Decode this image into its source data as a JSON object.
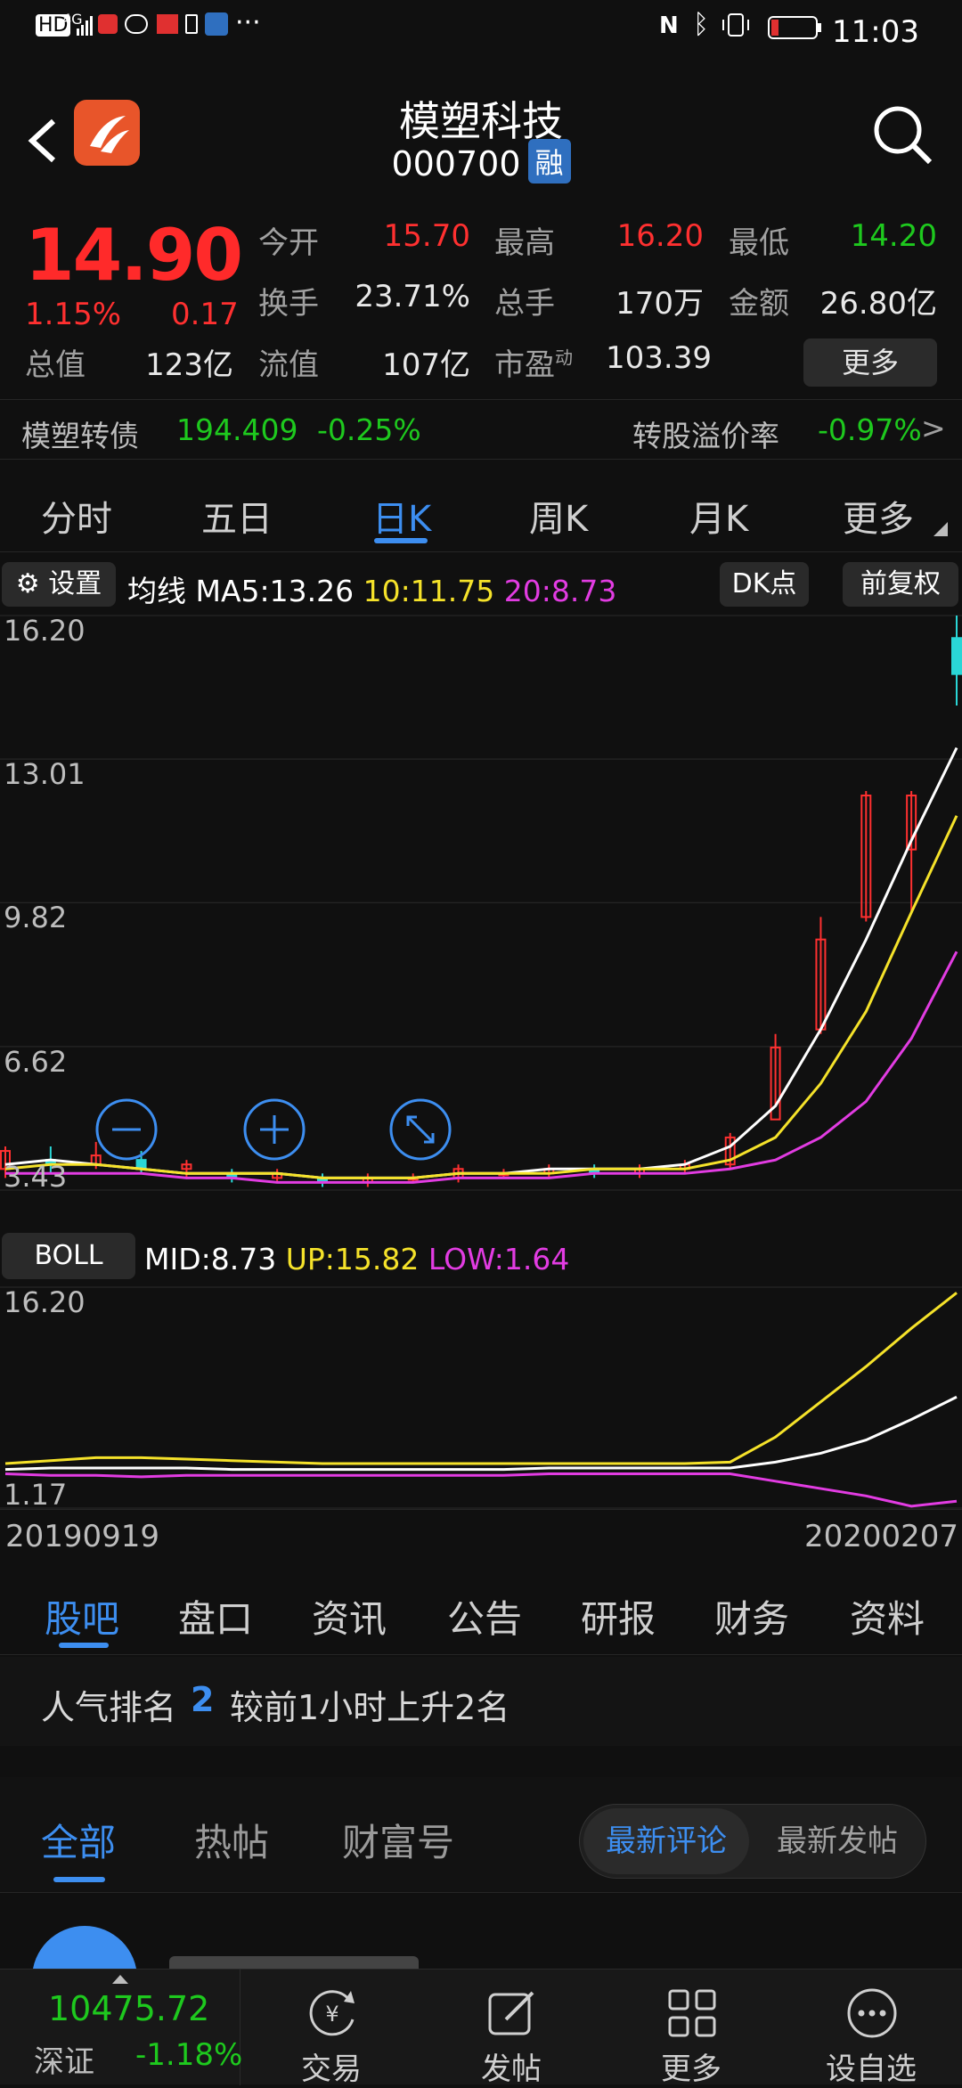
{
  "status": {
    "time": "11:03",
    "network": "4G",
    "hd": "HD",
    "more": "···"
  },
  "header": {
    "title": "模塑科技",
    "code": "000700",
    "badge": "融"
  },
  "quote": {
    "price": "14.90",
    "change_pct": "1.15%",
    "change": "0.17",
    "stats": [
      {
        "label": "今开",
        "value": "15.70"
      },
      {
        "label": "最高",
        "value": "16.20"
      },
      {
        "label": "最低",
        "value": "14.20"
      },
      {
        "label": "换手",
        "value": "23.71%"
      },
      {
        "label": "总手",
        "value": "170万"
      },
      {
        "label": "金额",
        "value": "26.80亿"
      },
      {
        "label": "总值",
        "value": "123亿"
      },
      {
        "label": "流值",
        "value": "107亿"
      },
      {
        "label": "市盈",
        "sup": "动",
        "value": "103.39"
      }
    ],
    "more_label": "更多"
  },
  "convertible": {
    "name": "模塑转债",
    "price": "194.409",
    "change": "-0.25%",
    "premium_label": "转股溢价率",
    "premium": "-0.97%",
    "arrow": ">"
  },
  "period_tabs": [
    "分时",
    "五日",
    "日K",
    "周K",
    "月K",
    "更多"
  ],
  "chart_bar": {
    "settings_label": "设置",
    "ma_label": "均线",
    "ma5": "MA5:13.26",
    "ma10": "10:11.75",
    "ma20": "20:8.73",
    "dk_label": "DK点",
    "adjust_label": "前复权"
  },
  "boll_bar": {
    "label": "BOLL",
    "mid": "MID:8.73",
    "up": "UP:15.82",
    "low": "LOW:1.64"
  },
  "axis": {
    "date_start": "20190919",
    "date_end": "20200207"
  },
  "colors": {
    "up": "#ff3030",
    "down": "#1ec91e",
    "accent": "#3d8ef0",
    "ma5": "#ffffff",
    "ma10": "#f5e22a",
    "ma20": "#e23ce2"
  },
  "chart_data": [
    {
      "type": "candlestick",
      "title": "",
      "y_ticks": [
        "16.20",
        "13.01",
        "9.82",
        "6.62",
        "3.43"
      ],
      "ylim": [
        3.43,
        16.2
      ],
      "x_range": [
        "20190919",
        "20200207"
      ],
      "series": [
        {
          "name": "MA5",
          "last": 13.26,
          "values": [
            4.0,
            4.1,
            4.0,
            3.9,
            3.8,
            3.8,
            3.8,
            3.7,
            3.7,
            3.7,
            3.8,
            3.8,
            3.9,
            3.9,
            3.9,
            4.0,
            4.4,
            5.3,
            7.0,
            9.0,
            11.2,
            13.26
          ]
        },
        {
          "name": "10",
          "last": 11.75,
          "values": [
            3.9,
            4.0,
            4.0,
            3.9,
            3.8,
            3.8,
            3.8,
            3.7,
            3.7,
            3.7,
            3.8,
            3.8,
            3.8,
            3.9,
            3.9,
            3.9,
            4.1,
            4.6,
            5.8,
            7.4,
            9.6,
            11.75
          ]
        },
        {
          "name": "20",
          "last": 8.73,
          "values": [
            3.8,
            3.8,
            3.8,
            3.8,
            3.7,
            3.7,
            3.6,
            3.6,
            3.6,
            3.6,
            3.7,
            3.7,
            3.7,
            3.8,
            3.8,
            3.8,
            3.9,
            4.1,
            4.6,
            5.4,
            6.8,
            8.73
          ]
        }
      ],
      "candles": [
        {
          "o": 3.9,
          "c": 4.3,
          "h": 4.4,
          "l": 3.7
        },
        {
          "o": 4.1,
          "c": 4.0,
          "h": 4.4,
          "l": 3.8
        },
        {
          "o": 4.0,
          "c": 4.2,
          "h": 4.5,
          "l": 3.9
        },
        {
          "o": 4.1,
          "c": 3.9,
          "h": 4.3,
          "l": 3.8
        },
        {
          "o": 3.9,
          "c": 4.0,
          "h": 4.1,
          "l": 3.7
        },
        {
          "o": 3.8,
          "c": 3.7,
          "h": 3.9,
          "l": 3.6
        },
        {
          "o": 3.7,
          "c": 3.8,
          "h": 3.9,
          "l": 3.6
        },
        {
          "o": 3.7,
          "c": 3.6,
          "h": 3.8,
          "l": 3.5
        },
        {
          "o": 3.6,
          "c": 3.7,
          "h": 3.8,
          "l": 3.5
        },
        {
          "o": 3.7,
          "c": 3.7,
          "h": 3.8,
          "l": 3.6
        },
        {
          "o": 3.7,
          "c": 3.9,
          "h": 4.0,
          "l": 3.6
        },
        {
          "o": 3.8,
          "c": 3.8,
          "h": 3.9,
          "l": 3.7
        },
        {
          "o": 3.8,
          "c": 3.9,
          "h": 4.0,
          "l": 3.7
        },
        {
          "o": 3.9,
          "c": 3.8,
          "h": 4.0,
          "l": 3.7
        },
        {
          "o": 3.8,
          "c": 3.9,
          "h": 4.0,
          "l": 3.7
        },
        {
          "o": 3.9,
          "c": 4.0,
          "h": 4.1,
          "l": 3.8
        },
        {
          "o": 4.0,
          "c": 4.6,
          "h": 4.7,
          "l": 3.9
        },
        {
          "o": 5.0,
          "c": 6.6,
          "h": 6.9,
          "l": 5.3
        },
        {
          "o": 7.0,
          "c": 9.0,
          "h": 9.5,
          "l": 6.9
        },
        {
          "o": 9.5,
          "c": 12.2,
          "h": 12.3,
          "l": 9.4
        },
        {
          "o": 11.0,
          "c": 12.2,
          "h": 12.3,
          "l": 9.6
        },
        {
          "o": 15.7,
          "c": 14.9,
          "h": 16.2,
          "l": 14.2
        }
      ]
    },
    {
      "type": "line",
      "title": "",
      "y_ticks": [
        "16.20",
        "1.17"
      ],
      "ylim": [
        1.17,
        16.2
      ],
      "series": [
        {
          "name": "MID",
          "last": 8.73,
          "values": [
            3.8,
            3.9,
            3.9,
            3.9,
            3.9,
            3.8,
            3.8,
            3.8,
            3.8,
            3.8,
            3.8,
            3.8,
            3.9,
            3.9,
            3.9,
            3.9,
            3.9,
            4.3,
            4.9,
            5.8,
            7.2,
            8.73
          ]
        },
        {
          "name": "UP",
          "last": 15.82,
          "values": [
            4.2,
            4.4,
            4.6,
            4.6,
            4.5,
            4.4,
            4.3,
            4.2,
            4.2,
            4.2,
            4.2,
            4.2,
            4.2,
            4.2,
            4.2,
            4.2,
            4.3,
            6.0,
            8.4,
            10.8,
            13.4,
            15.82
          ]
        },
        {
          "name": "LOW",
          "last": 1.64,
          "values": [
            3.5,
            3.4,
            3.4,
            3.3,
            3.4,
            3.4,
            3.4,
            3.4,
            3.4,
            3.4,
            3.4,
            3.4,
            3.5,
            3.5,
            3.5,
            3.5,
            3.5,
            3.0,
            2.5,
            2.0,
            1.3,
            1.64
          ]
        }
      ]
    }
  ],
  "sub_tabs": [
    "股吧",
    "盘口",
    "资讯",
    "公告",
    "研报",
    "财务",
    "资料"
  ],
  "rank": {
    "prefix": "人气排名",
    "value": "2",
    "note": "较前1小时上升2名"
  },
  "filter_tabs": [
    "全部",
    "热帖",
    "财富号"
  ],
  "segment": {
    "on": "最新评论",
    "off": "最新发帖"
  },
  "bottom_nav": {
    "index_value": "10475.72",
    "index_name": "深证",
    "index_change": "-1.18%",
    "items": [
      {
        "label": "交易",
        "icon": "yen-refresh-icon"
      },
      {
        "label": "发帖",
        "icon": "edit-icon"
      },
      {
        "label": "更多",
        "icon": "grid-icon"
      },
      {
        "label": "设自选",
        "icon": "more-dots-icon"
      }
    ]
  }
}
